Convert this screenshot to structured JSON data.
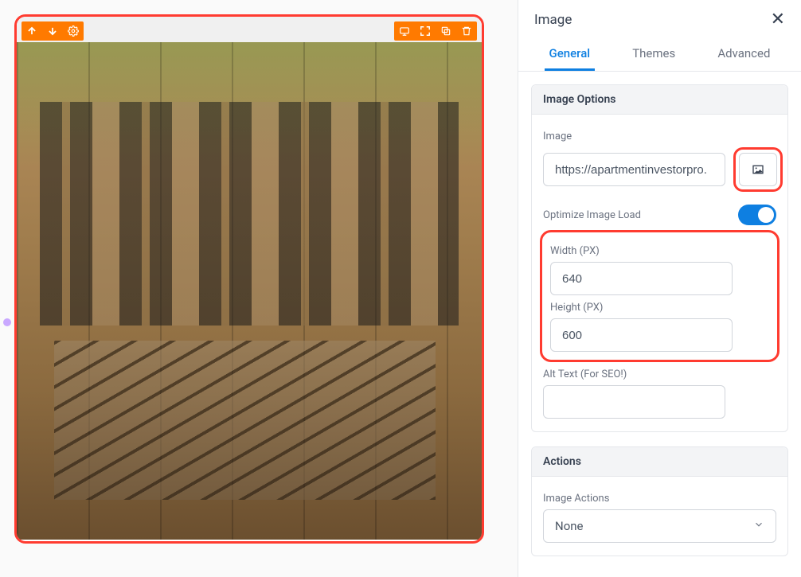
{
  "panel": {
    "title": "Image",
    "tabs": {
      "general": "General",
      "themes": "Themes",
      "advanced": "Advanced"
    }
  },
  "imageOptions": {
    "heading": "Image Options",
    "imageLabel": "Image",
    "imageUrl": "https://apartmentinvestorpro.",
    "optimizeLabel": "Optimize Image Load",
    "widthLabel": "Width (PX)",
    "widthValue": "640",
    "heightLabel": "Height (PX)",
    "heightValue": "600",
    "altLabel": "Alt Text (For SEO!)",
    "altValue": ""
  },
  "actions": {
    "heading": "Actions",
    "imageActionsLabel": "Image Actions",
    "selected": "None"
  }
}
